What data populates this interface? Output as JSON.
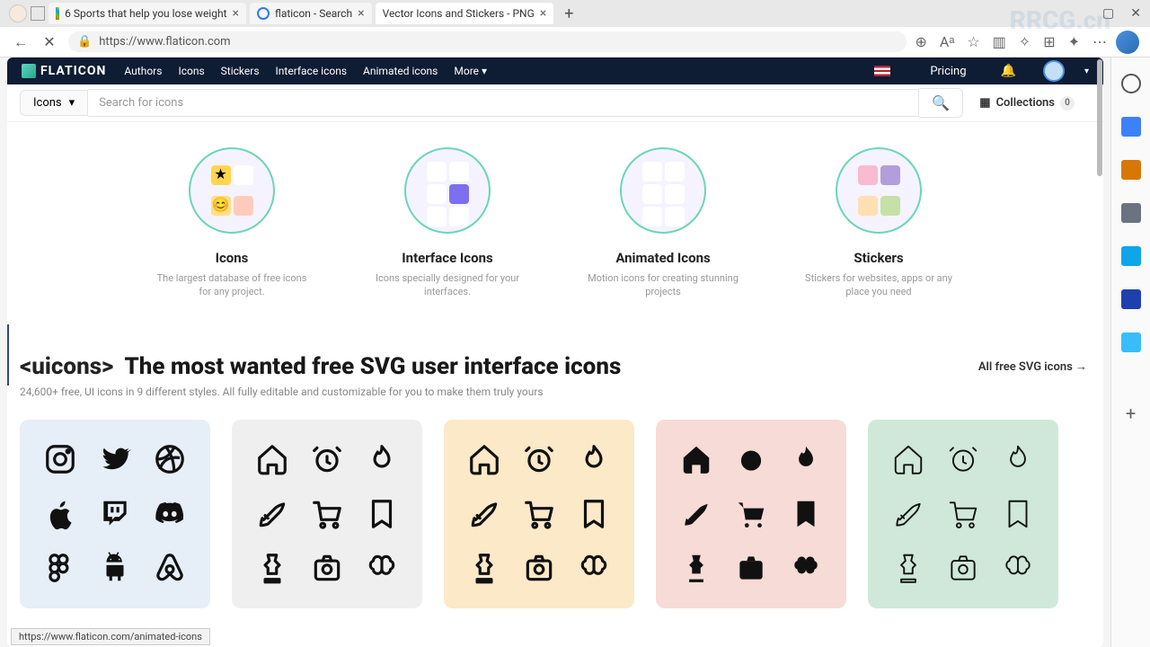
{
  "browser": {
    "tabs": [
      {
        "title": "6 Sports that help you lose weight"
      },
      {
        "title": "flaticon - Search"
      },
      {
        "title": "Vector Icons and Stickers - PNG"
      }
    ],
    "url": "https://www.flaticon.com",
    "status_url": "https://www.flaticon.com/animated-icons",
    "window_min": "—",
    "window_max": "▢",
    "window_close": "✕",
    "watermark_tr": "RRCG.cn"
  },
  "topnav": {
    "brand": "FLATICON",
    "links": [
      "Authors",
      "Icons",
      "Stickers",
      "Interface icons",
      "Animated icons"
    ],
    "more": "More",
    "pricing": "Pricing"
  },
  "search": {
    "dropdown_label": "Icons",
    "placeholder": "Search for icons",
    "collections_label": "Collections",
    "collections_count": "0"
  },
  "categories": [
    {
      "title": "Icons",
      "desc": "The largest database of free icons for any project."
    },
    {
      "title": "Interface Icons",
      "desc": "Icons specially designed for your interfaces."
    },
    {
      "title": "Animated Icons",
      "desc": "Motion icons for creating stunning projects"
    },
    {
      "title": "Stickers",
      "desc": "Stickers for websites, apps or any place you need"
    }
  ],
  "uicons": {
    "tag": "<uicons>",
    "title": "The most wanted free SVG user interface icons",
    "subtitle": "24,600+ free, UI icons in 9 different styles. All fully editable and customizable for you to make them truly yours",
    "all_link": "All free SVG icons  →"
  },
  "icon_cards": [
    {
      "bg": "#e6eef8",
      "style": "brands"
    },
    {
      "bg": "#efefef",
      "style": "outline"
    },
    {
      "bg": "#fbe9c7",
      "style": "outline"
    },
    {
      "bg": "#f7dbd6",
      "style": "solid"
    },
    {
      "bg": "#cfe8d9",
      "style": "thin"
    }
  ],
  "right_sidebar_colors": [
    "#555",
    "#3b82f6",
    "#d97706",
    "#6b7280",
    "#0ea5e9",
    "#1e40af",
    "#38bdf8"
  ]
}
